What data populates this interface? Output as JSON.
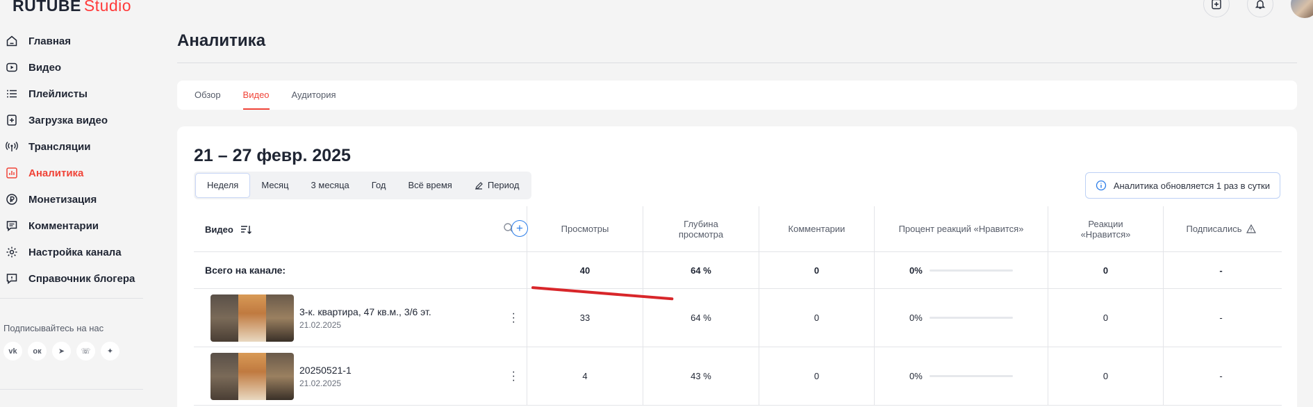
{
  "logo": {
    "brand": "RUTUBE",
    "studio": "Studio"
  },
  "sidebar": {
    "items": [
      {
        "label": "Главная",
        "icon": "home-icon"
      },
      {
        "label": "Видео",
        "icon": "video-icon"
      },
      {
        "label": "Плейлисты",
        "icon": "playlist-icon"
      },
      {
        "label": "Загрузка видео",
        "icon": "upload-icon"
      },
      {
        "label": "Трансляции",
        "icon": "broadcast-icon"
      },
      {
        "label": "Аналитика",
        "icon": "analytics-icon",
        "active": true
      },
      {
        "label": "Монетизация",
        "icon": "ruble-icon"
      },
      {
        "label": "Комментарии",
        "icon": "comment-icon"
      },
      {
        "label": "Настройка канала",
        "icon": "gear-icon"
      },
      {
        "label": "Справочник блогера",
        "icon": "guide-icon"
      }
    ],
    "follow_title": "Подписывайтесь на нас",
    "socials": [
      "vk",
      "ok",
      "telegram",
      "viber",
      "zen"
    ]
  },
  "page": {
    "title": "Аналитика"
  },
  "tabs": [
    {
      "label": "Обзор"
    },
    {
      "label": "Видео",
      "active": true
    },
    {
      "label": "Аудитория"
    }
  ],
  "period": {
    "title": "21 – 27 февр. 2025",
    "buttons": [
      "Неделя",
      "Месяц",
      "3 месяца",
      "Год",
      "Всё время",
      "Период"
    ],
    "active": "Неделя"
  },
  "info": {
    "text": "Аналитика обновляется 1 раз в сутки"
  },
  "table": {
    "video_header": "Видео",
    "columns": [
      "Просмотры",
      "Глубина просмотра",
      "Комментарии",
      "Процент реакций «Нравится»",
      "Реакции «Нравится»",
      "Подписались"
    ],
    "total": {
      "label": "Всего на канале:",
      "views": "40",
      "depth": "64 %",
      "comments": "0",
      "like_pct": "0%",
      "likes": "0",
      "subs": "-"
    },
    "rows": [
      {
        "title": "3-к. квартира, 47 кв.м., 3/6 эт.",
        "date": "21.02.2025",
        "views": "33",
        "depth": "64 %",
        "comments": "0",
        "like_pct": "0%",
        "likes": "0",
        "subs": "-"
      },
      {
        "title": "20250521-1",
        "date": "21.02.2025",
        "views": "4",
        "depth": "43 %",
        "comments": "0",
        "like_pct": "0%",
        "likes": "0",
        "subs": "-"
      }
    ]
  },
  "colors": {
    "accent": "#f04438",
    "link": "#2b7de9",
    "annotation": "#d8262a"
  }
}
